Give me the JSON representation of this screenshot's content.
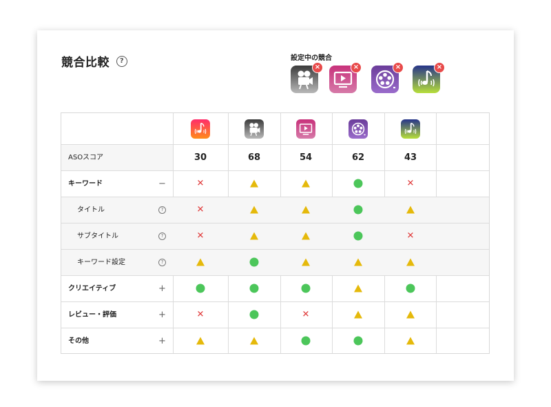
{
  "header": {
    "title": "競合比較",
    "help_glyph": "?",
    "competitors_label": "設定中の競合",
    "remove_glyph": "×"
  },
  "competitors": [
    {
      "icon": "video-camera-icon",
      "color_top": "#3b3b3b",
      "color_bottom": "#b9b9b9"
    },
    {
      "icon": "tv-play-icon",
      "color_top": "#c8327b",
      "color_bottom": "#d67aa8"
    },
    {
      "icon": "film-reel-icon",
      "color_top": "#6b3d9a",
      "color_bottom": "#9a6ccb"
    },
    {
      "icon": "music-note-icon",
      "color_top": "#26348a",
      "color_bottom": "#b7df3a"
    }
  ],
  "columns": [
    {
      "icon": "music-note-icon",
      "color_top": "#ff2d6a",
      "color_bottom": "#ff8c1a"
    },
    {
      "icon": "video-camera-icon",
      "color_top": "#3b3b3b",
      "color_bottom": "#b9b9b9"
    },
    {
      "icon": "tv-play-icon",
      "color_top": "#c8327b",
      "color_bottom": "#d67aa8"
    },
    {
      "icon": "film-reel-icon",
      "color_top": "#6b3d9a",
      "color_bottom": "#9a6ccb"
    },
    {
      "icon": "music-note-icon",
      "color_top": "#26348a",
      "color_bottom": "#b7df3a"
    }
  ],
  "aso": {
    "label": "ASOスコア",
    "scores": [
      "30",
      "68",
      "54",
      "62",
      "43"
    ]
  },
  "rows": [
    {
      "label": "キーワード",
      "bold": true,
      "indent": false,
      "control": "−",
      "marks": [
        "x",
        "tri",
        "tri",
        "circle",
        "x"
      ]
    },
    {
      "label": "タイトル",
      "bold": false,
      "indent": true,
      "control": "?",
      "marks": [
        "x",
        "tri",
        "tri",
        "circle",
        "tri"
      ]
    },
    {
      "label": "サブタイトル",
      "bold": false,
      "indent": true,
      "control": "?",
      "marks": [
        "x",
        "tri",
        "tri",
        "circle",
        "x"
      ]
    },
    {
      "label": "キーワード設定",
      "bold": false,
      "indent": true,
      "control": "?",
      "marks": [
        "tri",
        "circle",
        "tri",
        "tri",
        "tri"
      ]
    },
    {
      "label": "クリエイティブ",
      "bold": true,
      "indent": false,
      "control": "+",
      "marks": [
        "circle",
        "circle",
        "circle",
        "tri",
        "circle"
      ]
    },
    {
      "label": "レビュー・評価",
      "bold": true,
      "indent": false,
      "control": "+",
      "marks": [
        "x",
        "circle",
        "x",
        "tri",
        "tri"
      ]
    },
    {
      "label": "その他",
      "bold": true,
      "indent": false,
      "control": "+",
      "marks": [
        "tri",
        "tri",
        "circle",
        "circle",
        "tri"
      ]
    }
  ],
  "colors": {
    "circle": "#4cc65a",
    "triangle": "#e5b90b",
    "cross": "#e03a3a",
    "remove_badge": "#e84a4a"
  }
}
